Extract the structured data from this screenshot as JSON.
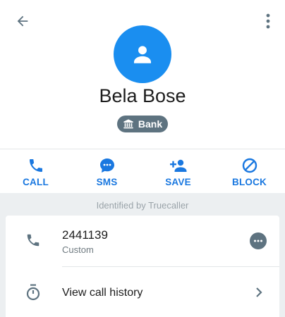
{
  "toolbar": {
    "back_icon": "arrow-back-icon",
    "more_icon": "more-vertical-icon"
  },
  "contact": {
    "name": "Bela Bose",
    "avatar_icon": "person-icon",
    "tag": {
      "label": "Bank",
      "icon": "bank-icon"
    }
  },
  "actions": [
    {
      "label": "CALL",
      "icon": "phone-icon"
    },
    {
      "label": "SMS",
      "icon": "chat-bubble-icon"
    },
    {
      "label": "SAVE",
      "icon": "add-person-icon"
    },
    {
      "label": "BLOCK",
      "icon": "block-icon"
    }
  ],
  "identified_text": "Identified by Truecaller",
  "phone": {
    "number": "2441139",
    "type": "Custom"
  },
  "history": {
    "label": "View call history"
  },
  "colors": {
    "accent": "#1a78e0",
    "avatar_bg": "#1a8ef0",
    "badge_bg": "#5e7380",
    "grey_bg": "#eceff1"
  }
}
